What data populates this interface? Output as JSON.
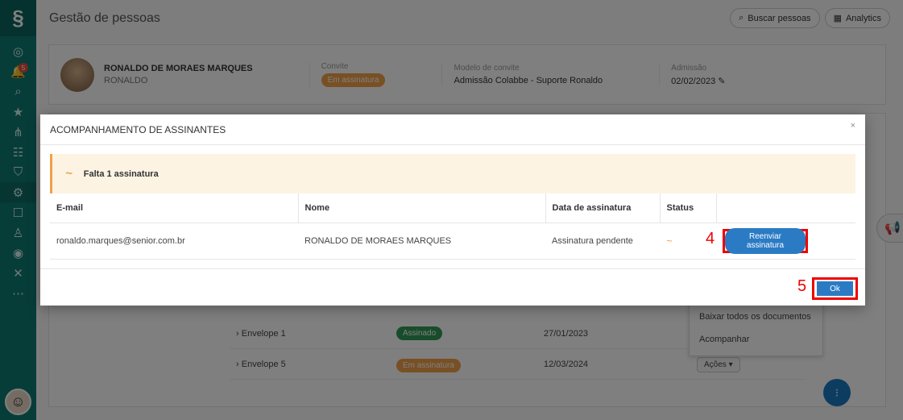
{
  "app": {
    "page_title": "Gestão de pessoas",
    "search_label": "Buscar pessoas",
    "analytics_label": "Analytics"
  },
  "sidebar": {
    "notification_count": "5"
  },
  "person": {
    "name": "RONALDO DE MORAES MARQUES",
    "short_name": "RONALDO",
    "convite_label": "Convite",
    "convite_status": "Em assinatura",
    "modelo_label": "Modelo de convite",
    "modelo_value": "Admissão Colabbe - Suporte Ronaldo",
    "admissao_label": "Admissão",
    "admissao_value": "02/02/2023"
  },
  "background_table": {
    "rows": [
      {
        "envelope": "Envelope 1",
        "status": "Assinado",
        "date": "27/01/2023"
      },
      {
        "envelope": "Envelope 5",
        "status": "Em assinatura",
        "date": "12/03/2024",
        "action": "Ações"
      }
    ],
    "dropdown": [
      "Baixar todos os documentos",
      "Acompanhar"
    ]
  },
  "modal": {
    "title": "ACOMPANHAMENTO DE ASSINANTES",
    "close": "×",
    "alert_text": "Falta 1 assinatura",
    "headers": [
      "E-mail",
      "Nome",
      "Data de assinatura",
      "Status"
    ],
    "row": {
      "email": "ronaldo.marques@senior.com.br",
      "name": "RONALDO DE MORAES MARQUES",
      "date": "Assinatura pendente",
      "resend_label": "Reenviar assinatura"
    },
    "ok_label": "Ok",
    "marker_4": "4",
    "marker_5": "5"
  }
}
